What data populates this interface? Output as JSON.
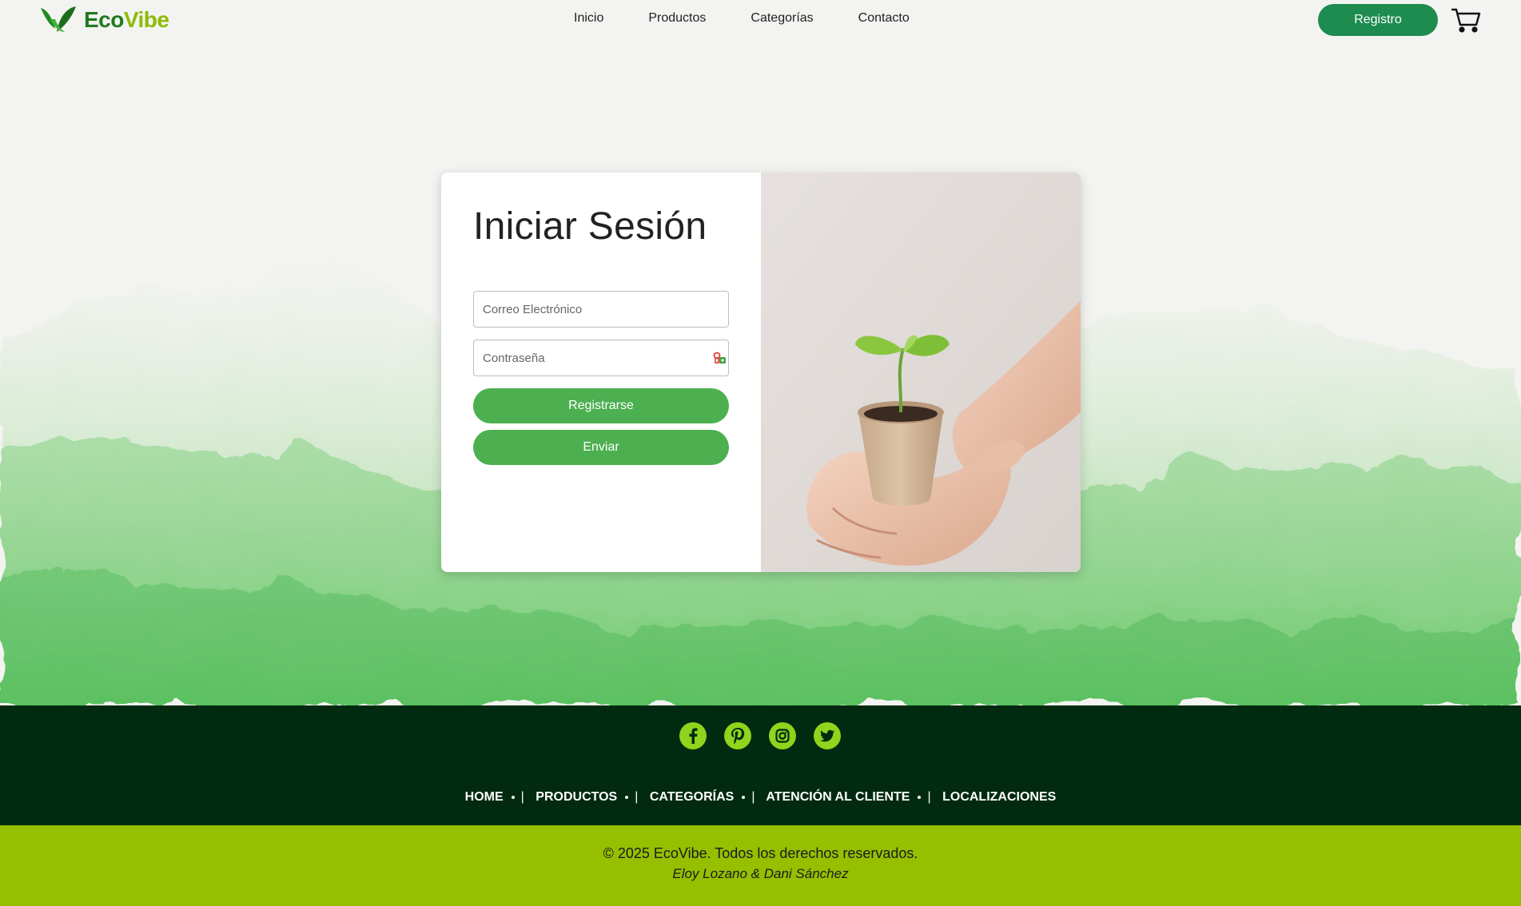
{
  "brand": {
    "name_part1": "Eco",
    "name_part2": "Vibe",
    "logo_icon": "leaf-v-icon"
  },
  "nav": {
    "items": [
      {
        "label": "Inicio"
      },
      {
        "label": "Productos"
      },
      {
        "label": "Categorías"
      },
      {
        "label": "Contacto"
      }
    ]
  },
  "header": {
    "register_label": "Registro",
    "cart_icon": "cart-icon"
  },
  "login": {
    "title": "Iniciar Sesión",
    "email_placeholder": "Correo Electrónico",
    "password_placeholder": "Contraseña",
    "password_icon": "password-key-icon",
    "register_button": "Registrarse",
    "submit_button": "Enviar"
  },
  "footer": {
    "socials": [
      "facebook-icon",
      "pinterest-icon",
      "instagram-icon",
      "twitter-icon"
    ],
    "links": [
      "HOME",
      "PRODUCTOS",
      "CATEGORÍAS",
      "ATENCIÓN AL CLIENTE",
      "LOCALIZACIONES"
    ],
    "separator": "|",
    "copyright": "© 2025 EcoVibe. Todos los derechos reservados.",
    "authors": "Eloy Lozano & Dani Sánchez"
  },
  "colors": {
    "primary_green": "#4caf50",
    "header_button": "#1d8c4e",
    "footer_dark": "#012a10",
    "footer_lime": "#96bf00",
    "social_icon": "#8fd41d",
    "logo_dark": "#1f7a1f",
    "logo_light": "#8dbb00"
  }
}
